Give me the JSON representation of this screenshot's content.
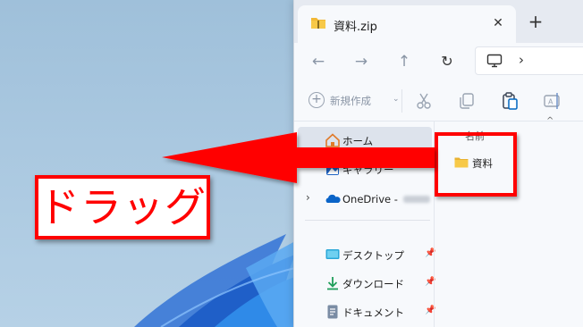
{
  "window": {
    "tab_title": "資料.zip",
    "tab_close_glyph": "✕",
    "tab_add_glyph": "+"
  },
  "navbar": {
    "back_glyph": "←",
    "forward_glyph": "→",
    "up_glyph": "↑",
    "refresh_glyph": "↻",
    "address_chevron": "›"
  },
  "toolbar": {
    "new_label": "新規作成",
    "new_plus": "+",
    "new_caret": "⌄",
    "icons": [
      "cut-icon",
      "copy-icon",
      "paste-icon",
      "rename-icon"
    ]
  },
  "sidebar": {
    "items": [
      {
        "label": "ホーム",
        "icon": "home-icon",
        "selected": true
      },
      {
        "label": "ギャラリー",
        "icon": "gallery-icon"
      },
      {
        "label": "OneDrive -",
        "icon": "onedrive-icon",
        "expand": "›"
      },
      {
        "label": "デスクトップ",
        "icon": "desktop-icon",
        "pin": "📌"
      },
      {
        "label": "ダウンロード",
        "icon": "download-icon",
        "pin": "📌"
      },
      {
        "label": "ドキュメント",
        "icon": "document-icon",
        "pin": "📌"
      }
    ]
  },
  "content": {
    "column_name": "名前",
    "sort_glyph": "^",
    "files": [
      {
        "name": "資料",
        "icon": "folder-icon"
      }
    ]
  },
  "annotation": {
    "drag_label": "ドラッグ"
  },
  "colors": {
    "annotation_red": "#ff0000",
    "folder_yellow": "#f7c948",
    "accent_blue": "#0067c0"
  }
}
